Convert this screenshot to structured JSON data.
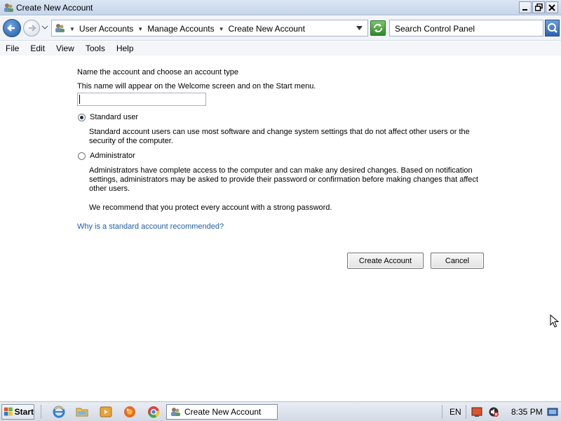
{
  "window": {
    "title": "Create New Account",
    "buttons": {
      "minimize": "_",
      "restore": "❐",
      "close": "✕"
    }
  },
  "address_bar": {
    "breadcrumbs": [
      "User Accounts",
      "Manage Accounts",
      "Create New Account"
    ],
    "search_placeholder": "Search Control Panel"
  },
  "menu": [
    "File",
    "Edit",
    "View",
    "Tools",
    "Help"
  ],
  "form": {
    "heading": "Name the account and choose an account type",
    "subheading": "This name will appear on the Welcome screen and on the Start menu.",
    "name_value": "",
    "options": [
      {
        "label": "Standard user",
        "checked": true,
        "description": "Standard account users can use most software and change system settings that do not affect other users or the security of the computer."
      },
      {
        "label": "Administrator",
        "checked": false,
        "description": "Administrators have complete access to the computer and can make any desired changes. Based on notification settings, administrators may be asked to provide their password or confirmation before making changes that affect other users."
      }
    ],
    "recommendation": "We recommend that you protect every account with a strong password.",
    "help_link": "Why is a standard account recommended?",
    "create_button": "Create Account",
    "cancel_button": "Cancel"
  },
  "taskbar": {
    "start_label": "Start",
    "quick_launch": [
      "internet-explorer-icon",
      "folder-icon",
      "media-player-icon",
      "firefox-icon",
      "chrome-icon"
    ],
    "active_task": "Create New Account",
    "language": "EN",
    "clock": "8:35 PM"
  },
  "colors": {
    "link": "#1e5ea7",
    "titlebar": "#c5d5ea"
  }
}
